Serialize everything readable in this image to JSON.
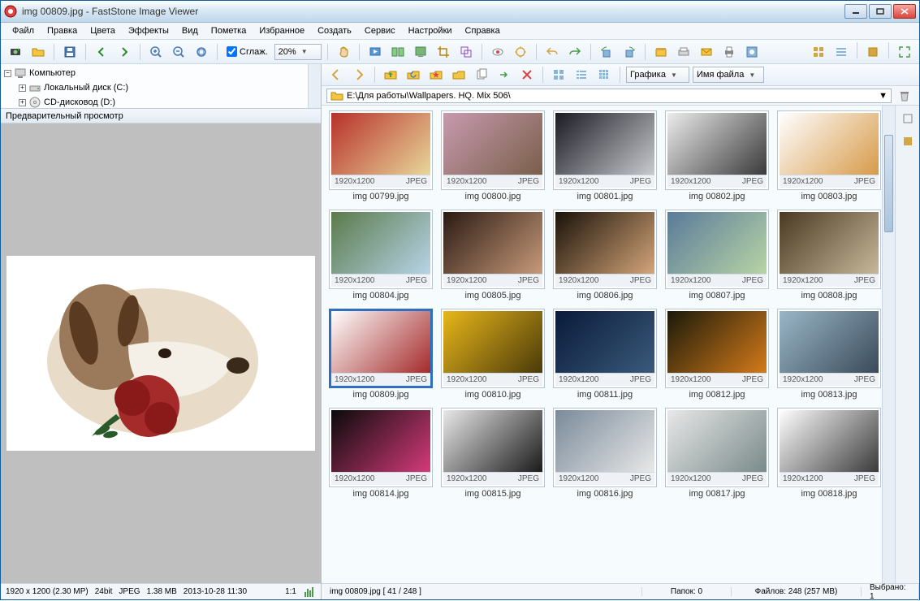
{
  "window": {
    "title": "img 00809.jpg  -  FastStone Image Viewer"
  },
  "menu": [
    "Файл",
    "Правка",
    "Цвета",
    "Эффекты",
    "Вид",
    "Пометка",
    "Избранное",
    "Создать",
    "Сервис",
    "Настройки",
    "Справка"
  ],
  "toolbar1": {
    "smooth_label": "Сглаж.",
    "zoom_value": "20%"
  },
  "tree": {
    "root": "Компьютер",
    "drives": [
      "Локальный диск (C:)",
      "CD-дисковод (D:)"
    ]
  },
  "preview_header": "Предварительный просмотр",
  "status_left": {
    "dims": "1920 x 1200 (2.30 MP)",
    "depth": "24bit",
    "fmt": "JPEG",
    "size": "1.38 MB",
    "date": "2013-10-28  11:30",
    "ratio": "1:1"
  },
  "toolbar2": {
    "view_combo": "Графика",
    "sort_combo": "Имя файла"
  },
  "path": "E:\\Для работы\\Wallpapers. HQ. Mix 506\\",
  "thumbs_common": {
    "dims": "1920x1200",
    "fmt": "JPEG"
  },
  "thumbs": [
    {
      "name": "img 00799.jpg",
      "bg": "#b7302a,#e8d79a",
      "sel": false
    },
    {
      "name": "img 00800.jpg",
      "bg": "#c79aaf,#7a5f4a",
      "sel": false
    },
    {
      "name": "img 00801.jpg",
      "bg": "#1a1a22,#c9c9d0",
      "sel": false
    },
    {
      "name": "img 00802.jpg",
      "bg": "#ececec,#3a3a3a",
      "sel": false
    },
    {
      "name": "img 00803.jpg",
      "bg": "#ffffff,#d79a4a",
      "sel": false
    },
    {
      "name": "img 00804.jpg",
      "bg": "#5a7a4a,#b7d4e8",
      "sel": false
    },
    {
      "name": "img 00805.jpg",
      "bg": "#2a1a12,#c79a7a",
      "sel": false
    },
    {
      "name": "img 00806.jpg",
      "bg": "#1a1208,#d4a57a",
      "sel": false
    },
    {
      "name": "img 00807.jpg",
      "bg": "#5a7a9a,#b7d4a5",
      "sel": false
    },
    {
      "name": "img 00808.jpg",
      "bg": "#4a3a22,#c7b79a",
      "sel": false
    },
    {
      "name": "img 00809.jpg",
      "bg": "#ffffff,#a52a2a",
      "sel": true
    },
    {
      "name": "img 00810.jpg",
      "bg": "#e8b71a,#4a3a0a",
      "sel": false
    },
    {
      "name": "img 00811.jpg",
      "bg": "#0a1a3a,#3a5a7a",
      "sel": false
    },
    {
      "name": "img 00812.jpg",
      "bg": "#1a1a0a,#d47a1a",
      "sel": false
    },
    {
      "name": "img 00813.jpg",
      "bg": "#9ab7c7,#3a4a5a",
      "sel": false
    },
    {
      "name": "img 00814.jpg",
      "bg": "#0a0a0a,#d43a7a",
      "sel": false
    },
    {
      "name": "img 00815.jpg",
      "bg": "#e8e8e8,#1a1a1a",
      "sel": false
    },
    {
      "name": "img 00816.jpg",
      "bg": "#7a8a9a,#e8e8e8",
      "sel": false
    },
    {
      "name": "img 00817.jpg",
      "bg": "#e8e8e8,#7a8a8a",
      "sel": false
    },
    {
      "name": "img 00818.jpg",
      "bg": "#ffffff,#3a3a3a",
      "sel": false
    }
  ],
  "status_right": {
    "current": "img 00809.jpg  [ 41 / 248 ]",
    "folders": "Папок: 0",
    "files": "Файлов: 248 (257 MB)",
    "selected": "Выбрано: 1"
  }
}
